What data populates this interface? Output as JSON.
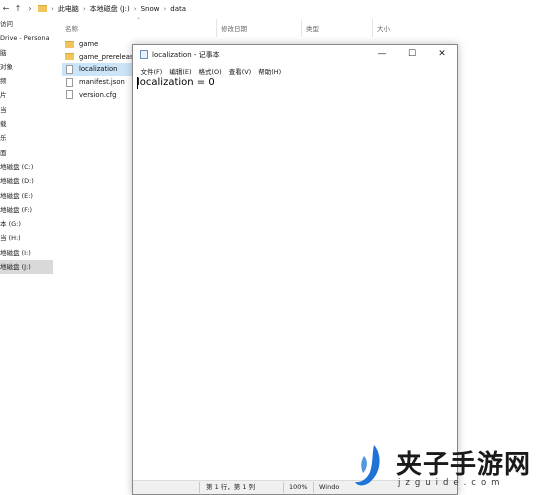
{
  "explorer": {
    "breadcrumb": [
      "此电脑",
      "本地磁盘 (J:)",
      "Snow",
      "data"
    ],
    "nav_items": [
      {
        "label": "访问",
        "selected": false
      },
      {
        "label": "Drive - Persona",
        "selected": false
      },
      {
        "label": "脑",
        "selected": false
      },
      {
        "label": "对象",
        "selected": false
      },
      {
        "label": "频",
        "selected": false
      },
      {
        "label": "片",
        "selected": false
      },
      {
        "label": "当",
        "selected": false
      },
      {
        "label": "载",
        "selected": false
      },
      {
        "label": "乐",
        "selected": false
      },
      {
        "label": "面",
        "selected": false
      },
      {
        "label": "地磁盘 (C:)",
        "selected": false
      },
      {
        "label": "地磁盘 (D:)",
        "selected": false
      },
      {
        "label": "地磁盘 (E:)",
        "selected": false
      },
      {
        "label": "地磁盘 (F:)",
        "selected": false
      },
      {
        "label": "本 (G:)",
        "selected": false
      },
      {
        "label": "当 (H:)",
        "selected": false
      },
      {
        "label": "地磁盘 (I:)",
        "selected": false
      },
      {
        "label": "地磁盘 (J:)",
        "selected": true
      }
    ],
    "columns": {
      "name": "名称",
      "modified": "修改日期",
      "type": "类型",
      "size": "大小"
    },
    "files": [
      {
        "name": "game",
        "kind": "folder",
        "selected": false
      },
      {
        "name": "game_prerelease",
        "kind": "folder",
        "selected": false
      },
      {
        "name": "localization",
        "kind": "file",
        "selected": true
      },
      {
        "name": "manifest.json",
        "kind": "file",
        "selected": false
      },
      {
        "name": "version.cfg",
        "kind": "file",
        "selected": false
      }
    ]
  },
  "notepad": {
    "title": "localization - 记事本",
    "window_buttons": {
      "minimize": "—",
      "maximize": "☐",
      "close": "✕"
    },
    "menu": [
      "文件(F)",
      "编辑(E)",
      "格式(O)",
      "查看(V)",
      "帮助(H)"
    ],
    "content": "localization = 0",
    "status": {
      "position": "第 1 行，第 1 列",
      "zoom": "100%",
      "line_ending": "Windo"
    }
  },
  "watermark": {
    "cn": "夹子手游网",
    "en": "jzguide.com"
  },
  "colors": {
    "folder": "#f2c55c",
    "selection": "#cce4f7",
    "nav_selected": "#d9d9d9",
    "logo_blue": "#1e73d6"
  }
}
